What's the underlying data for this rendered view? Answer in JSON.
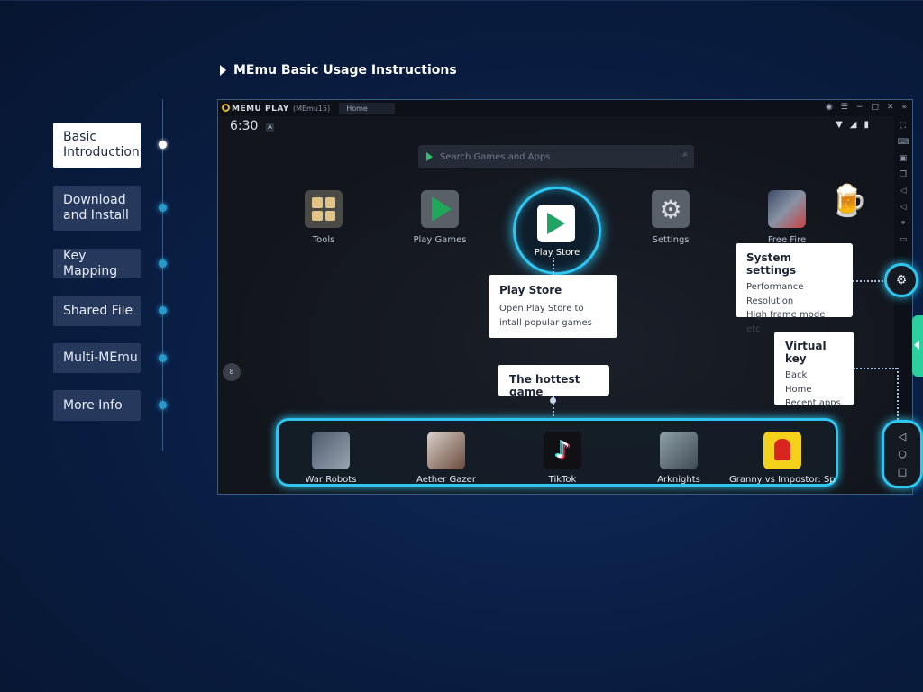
{
  "section_title": "MEmu Basic Usage Instructions",
  "nav": {
    "items": [
      {
        "label": "Basic Introduction",
        "active": true
      },
      {
        "label": "Download and Install"
      },
      {
        "label": "Key Mapping"
      },
      {
        "label": "Shared File"
      },
      {
        "label": "Multi-MEmu"
      },
      {
        "label": "More Info"
      }
    ]
  },
  "emulator": {
    "logo": "MEMU PLAY",
    "instance": "(MEmu15)",
    "tab": "Home",
    "clock": "6:30",
    "badge": "A",
    "search_placeholder": "Search Games and Apps",
    "apps": [
      {
        "label": "Tools",
        "icon": "tools-icon"
      },
      {
        "label": "Play Games",
        "icon": "play-games-icon"
      },
      {
        "label": "Play Store",
        "icon": "play-store-icon"
      },
      {
        "label": "Settings",
        "icon": "settings-icon"
      },
      {
        "label": "Free Fire",
        "icon": "free-fire-icon"
      }
    ],
    "dock": [
      {
        "label": "War Robots",
        "icon": "war-robots-icon"
      },
      {
        "label": "Aether Gazer",
        "icon": "aether-gazer-icon"
      },
      {
        "label": "TikTok",
        "icon": "tiktok-icon"
      },
      {
        "label": "Arknights",
        "icon": "arknights-icon"
      },
      {
        "label": "Granny vs Impostor: Spy M",
        "icon": "granny-icon"
      }
    ],
    "left_badge": "8"
  },
  "callouts": {
    "play_store": {
      "title": "Play Store",
      "desc": "Open Play Store to intall popular games"
    },
    "hottest": {
      "title": "The hottest game"
    },
    "system": {
      "title": "System settings",
      "items": [
        "Performance",
        "Resolution",
        "High frame mode etc"
      ]
    },
    "virtual": {
      "title": "Virtual key",
      "items": [
        "Back",
        "Home",
        "Recent apps"
      ]
    }
  },
  "colors": {
    "accent": "#2ec6f0",
    "background": "#0a1f45",
    "side_tab": "#2ad09e"
  }
}
